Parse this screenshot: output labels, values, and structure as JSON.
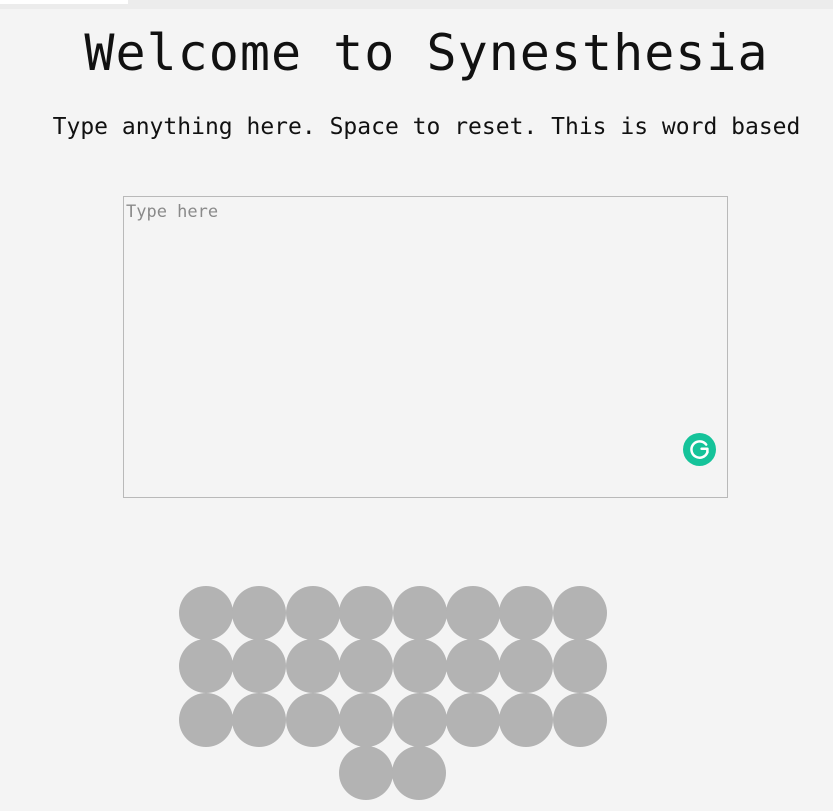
{
  "page": {
    "title": "Welcome to Synesthesia",
    "subtitle": "Type anything here. Space to reset. This is word based"
  },
  "editor": {
    "placeholder": "Type here",
    "value": ""
  },
  "grammar_widget": {
    "icon": "grammarly-g-icon",
    "color": "#15c39a"
  },
  "color_grid": {
    "circle_color": "#b3b3b3",
    "background_color": "#f4f4f4",
    "rows": [
      8,
      8,
      8,
      2
    ]
  }
}
